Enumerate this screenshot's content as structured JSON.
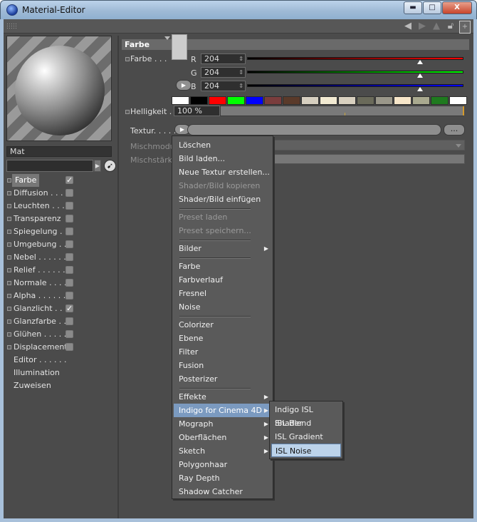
{
  "window": {
    "title": "Material-Editor"
  },
  "titlebar_buttons": {
    "minimize": "▬",
    "maximize": "□",
    "close": "X"
  },
  "toolbar_icons": [
    "back-arrow-icon",
    "forward-arrow-icon",
    "up-arrow-icon",
    "lock-icon",
    "new-window-icon"
  ],
  "material": {
    "name": "Mat"
  },
  "channels": [
    {
      "label": "Farbe",
      "checked": true,
      "selected": true
    },
    {
      "label": "Diffusion . . . .",
      "checked": false
    },
    {
      "label": "Leuchten . . . .",
      "checked": false
    },
    {
      "label": "Transparenz",
      "checked": false
    },
    {
      "label": "Spiegelung . .",
      "checked": false
    },
    {
      "label": "Umgebung . .",
      "checked": false
    },
    {
      "label": "Nebel . . . . . .",
      "checked": false
    },
    {
      "label": "Relief . . . . . .",
      "checked": false
    },
    {
      "label": "Normale . . . .",
      "checked": false
    },
    {
      "label": "Alpha . . . . . .",
      "checked": false
    },
    {
      "label": "Glanzlicht . . .",
      "checked": true
    },
    {
      "label": "Glanzfarbe . .",
      "checked": false
    },
    {
      "label": "Glühen . . . . .",
      "checked": false
    },
    {
      "label": "Displacement",
      "checked": false
    },
    {
      "label": "Editor . . . . . .",
      "plain": true
    },
    {
      "label": "Illumination",
      "plain": true
    },
    {
      "label": "Zuweisen",
      "plain": true
    }
  ],
  "section": {
    "title": "Farbe"
  },
  "color": {
    "label": "Farbe . . .",
    "swatch": "#cccccc",
    "channels": [
      {
        "name": "R",
        "value": "204",
        "level": 0.8,
        "gradient": "linear-gradient(90deg,#000,#ff0000)"
      },
      {
        "name": "G",
        "value": "204",
        "level": 0.8,
        "gradient": "linear-gradient(90deg,#000,#00ff00)"
      },
      {
        "name": "B",
        "value": "204",
        "level": 0.8,
        "gradient": "linear-gradient(90deg,#000,#0000ff)"
      }
    ],
    "palette": [
      "#ffffff",
      "#000000",
      "#ff0000",
      "#00ff00",
      "#0000ff",
      "#7a3d3d",
      "#5a3a2a",
      "#d6cfc0",
      "#f2ead2",
      "#d8d0bf",
      "#6a6a5a",
      "#9a978a",
      "#f7e6c9",
      "#a9a98f",
      "#1f7a1f",
      "#ffffff"
    ]
  },
  "brightness": {
    "label": "Helligkeit . .",
    "value": "100 %",
    "level": 1.0
  },
  "texture": {
    "label": "Textur. . . . .",
    "button": "...",
    "mix_mode_label": "Mischmodus",
    "mix_strength_label": "Mischstärke"
  },
  "context_menu": {
    "items": [
      {
        "label": "Löschen"
      },
      {
        "label": "Bild laden..."
      },
      {
        "label": "Neue Textur erstellen..."
      },
      {
        "label": "Shader/Bild kopieren",
        "disabled": true
      },
      {
        "label": "Shader/Bild einfügen"
      },
      {
        "sep": true
      },
      {
        "label": "Preset laden",
        "disabled": true
      },
      {
        "label": "Preset speichern...",
        "disabled": true
      },
      {
        "sep": true
      },
      {
        "label": "Bilder",
        "submenu": true
      },
      {
        "sep": true
      },
      {
        "label": "Farbe"
      },
      {
        "label": "Farbverlauf"
      },
      {
        "label": "Fresnel"
      },
      {
        "label": "Noise"
      },
      {
        "sep": true
      },
      {
        "label": "Colorizer"
      },
      {
        "label": "Ebene"
      },
      {
        "label": "Filter"
      },
      {
        "label": "Fusion"
      },
      {
        "label": "Posterizer"
      },
      {
        "sep": true
      },
      {
        "label": "Effekte",
        "submenu": true
      },
      {
        "label": "Indigo for Cinema 4D",
        "submenu": true,
        "highlighted": true
      },
      {
        "label": "Mograph",
        "submenu": true
      },
      {
        "label": "Oberflächen",
        "submenu": true
      },
      {
        "label": "Sketch",
        "submenu": true
      },
      {
        "label": "Polygonhaar"
      },
      {
        "label": "Ray Depth"
      },
      {
        "label": "Shadow Catcher"
      }
    ]
  },
  "submenu": {
    "items": [
      {
        "label": "Indigo ISL Shader"
      },
      {
        "label": "ISL Blend"
      },
      {
        "label": "ISL Gradient"
      },
      {
        "label": "ISL Noise",
        "highlighted": true
      }
    ]
  }
}
